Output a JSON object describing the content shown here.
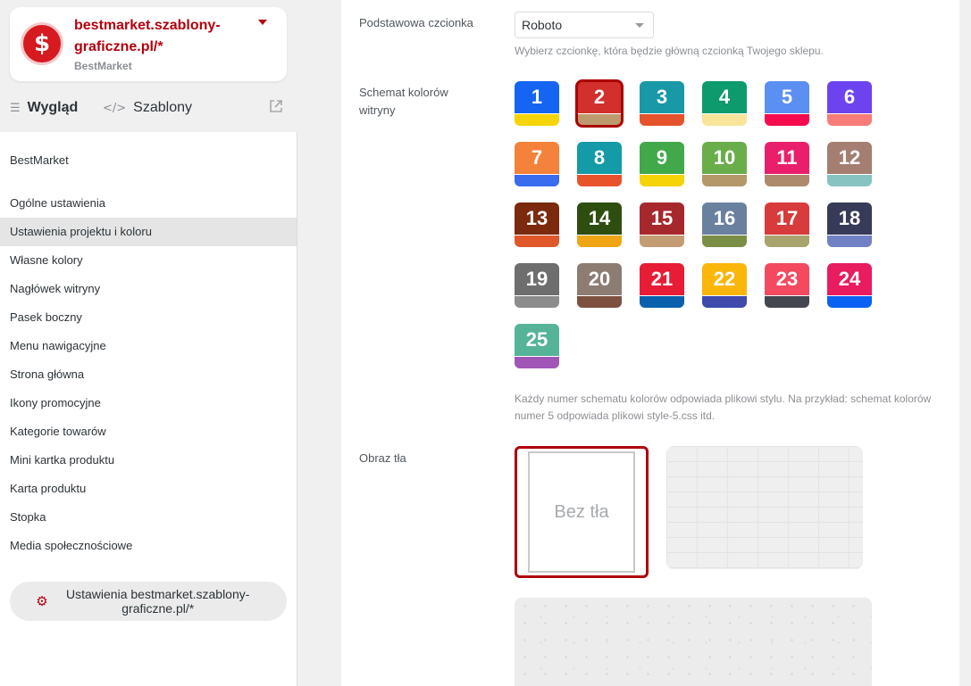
{
  "store": {
    "name": "bestmarket.szablony-graficzne.pl/*",
    "subtitle": "BestMarket",
    "logo_symbol": "$"
  },
  "tabs": [
    {
      "label": "Wygląd",
      "icon": "list-icon"
    },
    {
      "label": "Szablony",
      "icon": "code-icon"
    }
  ],
  "sidebar": {
    "brand": "BestMarket",
    "items": [
      {
        "label": "Ogólne ustawienia"
      },
      {
        "label": "Ustawienia projektu i koloru"
      },
      {
        "label": "Własne kolory"
      },
      {
        "label": "Nagłówek witryny"
      },
      {
        "label": "Pasek boczny"
      },
      {
        "label": "Menu nawigacyjne"
      },
      {
        "label": "Strona główna"
      },
      {
        "label": "Ikony promocyjne"
      },
      {
        "label": "Kategorie towarów"
      },
      {
        "label": "Mini kartka produktu"
      },
      {
        "label": "Karta produktu"
      },
      {
        "label": "Stopka"
      },
      {
        "label": "Media społecznościowe"
      }
    ],
    "settings_button": "Ustawienia bestmarket.szablony-graficzne.pl/*"
  },
  "font": {
    "label": "Podstawowa czcionka",
    "value": "Roboto",
    "hint": "Wybierz czcionkę, która będzie główną czcionką Twojego sklepu."
  },
  "scheme": {
    "label": "Schemat kolorów witryny",
    "selected": "2",
    "hint": "Każdy numer schematu kolorów odpowiada plikowi stylu. Na przykład: schemat kolorów numer 5 odpowiada plikowi style-5.css itd.",
    "swatches": [
      {
        "n": "1",
        "top": "#1565f2",
        "bottom": "#f5d50a"
      },
      {
        "n": "2",
        "top": "#d2302c",
        "bottom": "#bd9a6e"
      },
      {
        "n": "3",
        "top": "#1998a8",
        "bottom": "#e5532d"
      },
      {
        "n": "4",
        "top": "#0d9a6c",
        "bottom": "#f9e49a"
      },
      {
        "n": "5",
        "top": "#5b8ff2",
        "bottom": "#f50b4e"
      },
      {
        "n": "6",
        "top": "#6d43f0",
        "bottom": "#f77c77"
      },
      {
        "n": "7",
        "top": "#f5823a",
        "bottom": "#3a6cf0"
      },
      {
        "n": "8",
        "top": "#159aa8",
        "bottom": "#e8532c"
      },
      {
        "n": "9",
        "top": "#41a94a",
        "bottom": "#f6d307"
      },
      {
        "n": "10",
        "top": "#6aad4b",
        "bottom": "#b4986a"
      },
      {
        "n": "11",
        "top": "#ea1f6b",
        "bottom": "#ad8a6c"
      },
      {
        "n": "12",
        "top": "#a47e70",
        "bottom": "#87c3c0"
      },
      {
        "n": "13",
        "top": "#7b2a0e",
        "bottom": "#e0582a"
      },
      {
        "n": "14",
        "top": "#2e4e10",
        "bottom": "#f0a515"
      },
      {
        "n": "15",
        "top": "#a6282d",
        "bottom": "#c39c73"
      },
      {
        "n": "16",
        "top": "#6a809f",
        "bottom": "#7b8e45"
      },
      {
        "n": "17",
        "top": "#d83b3b",
        "bottom": "#a9a36d"
      },
      {
        "n": "18",
        "top": "#383a5a",
        "bottom": "#7281c6"
      },
      {
        "n": "19",
        "top": "#6e6e6e",
        "bottom": "#8c8c8c"
      },
      {
        "n": "20",
        "top": "#8d7c72",
        "bottom": "#7d5040"
      },
      {
        "n": "21",
        "top": "#e81c34",
        "bottom": "#0a60ad"
      },
      {
        "n": "22",
        "top": "#fbb60a",
        "bottom": "#3e4aac"
      },
      {
        "n": "23",
        "top": "#f34a60",
        "bottom": "#444750"
      },
      {
        "n": "24",
        "top": "#e81c5e",
        "bottom": "#0b62f2"
      },
      {
        "n": "25",
        "top": "#55b398",
        "bottom": "#a155b7"
      }
    ]
  },
  "background": {
    "label": "Obraz tła",
    "none_label": "Bez tła"
  }
}
